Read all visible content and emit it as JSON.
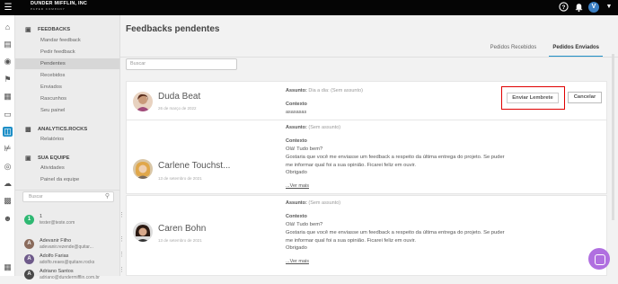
{
  "app": {
    "logo_main": "DUNDER MIFFLIN, INC",
    "logo_sub": "PAPER COMPANY",
    "avatar_initial": "V",
    "colors": {
      "accent": "#1e8fc7",
      "topbar": "#050505",
      "highlight_border": "#e00000",
      "chat": "#b06fe0"
    }
  },
  "sidebar": {
    "feedbacks": {
      "header": "FEEDBACKS",
      "items": [
        "Mandar feedback",
        "Pedir feedback",
        "Pendentes",
        "Recebidos",
        "Enviados",
        "Rascunhos",
        "Seu painel"
      ],
      "selected": "Pendentes"
    },
    "analytics": {
      "header": "ANALYTICS.ROCKS",
      "items": [
        "Relatórios"
      ]
    },
    "team": {
      "header": "SUA EQUIPE",
      "items": [
        "Atividades",
        "Painel da equipe"
      ]
    },
    "search_placeholder": "Buscar",
    "members": [
      {
        "avatar": "1",
        "name": "1",
        "email": "tester@teste.com"
      },
      {
        "avatar": "A",
        "name": "Adevanir Filho",
        "email": "adevanir.rezende@quitar..."
      },
      {
        "avatar": "A",
        "name": "Adolfo Farias",
        "email": "adolfo.reaes@quitare.rocks"
      },
      {
        "avatar": "A",
        "name": "Adriano Santos",
        "email": "adriano@dundermifflin.com.br"
      }
    ]
  },
  "main": {
    "title": "Feedbacks pendentes",
    "tabs": [
      {
        "label": "Pedidos Recebidos",
        "active": false
      },
      {
        "label": "Pedidos Enviados",
        "active": true
      }
    ],
    "search_placeholder": "Buscar",
    "cards": [
      {
        "name": "Duda Beat",
        "date": "26 de março de 2022",
        "subject_label": "Assunto:",
        "subject_value": "Dia a dia: (Sem assunto)",
        "context_label": "Contexto",
        "context_text": "asasasas",
        "btn_remind": "Enviar Lembrete",
        "btn_cancel": "Cancelar"
      },
      {
        "name": "Carlene Touchst...",
        "date": "13 de setembro de 2021",
        "subject_label": "Assunto:",
        "subject_value": "(Sem assunto)",
        "context_label": "Contexto",
        "message": [
          "Olá! Tudo bem?",
          "Gostaria que você me enviasse um feedback a respeito da última entrega do projeto. Se puder me informar qual foi a sua opinião. Ficarei feliz em ouvir.",
          "Obrigado"
        ],
        "more": "...Ver mais"
      },
      {
        "name": "Caren Bohn",
        "date": "13 de setembro de 2021",
        "subject_label": "Assunto:",
        "subject_value": "(Sem assunto)",
        "context_label": "Contexto",
        "message": [
          "Olá! Tudo bem?",
          "Gostaria que você me enviasse um feedback a respeito da última entrega do projeto. Se puder me informar qual foi a sua opinião. Ficarei feliz em ouvir.",
          "Obrigado"
        ],
        "more": "...Ver mais"
      }
    ]
  }
}
